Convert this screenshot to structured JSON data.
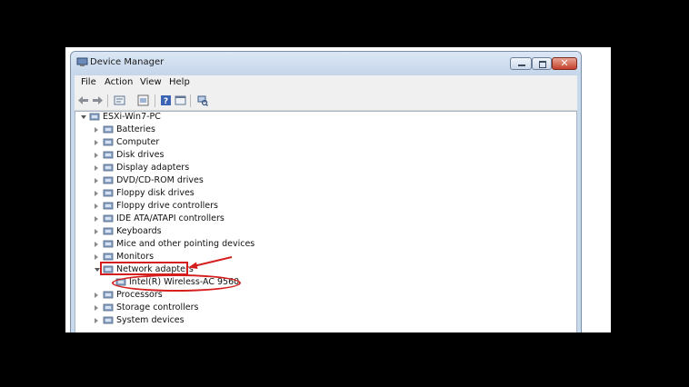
{
  "window": {
    "title": "Device Manager"
  },
  "menu": [
    "File",
    "Action",
    "View",
    "Help"
  ],
  "toolbar": [
    "back-icon",
    "forward-icon",
    "properties-icon",
    "show-hide-icon",
    "help-icon",
    "console-tree-icon",
    "scan-hardware-icon"
  ],
  "tree": {
    "root": "ESXi-Win7-PC",
    "items": [
      {
        "label": "Batteries",
        "icon": "battery-icon"
      },
      {
        "label": "Computer",
        "icon": "computer-icon"
      },
      {
        "label": "Disk drives",
        "icon": "disk-drive-icon"
      },
      {
        "label": "Display adapters",
        "icon": "display-adapter-icon"
      },
      {
        "label": "DVD/CD-ROM drives",
        "icon": "dvd-drive-icon"
      },
      {
        "label": "Floppy disk drives",
        "icon": "floppy-disk-icon"
      },
      {
        "label": "Floppy drive controllers",
        "icon": "floppy-controller-icon"
      },
      {
        "label": "IDE ATA/ATAPI controllers",
        "icon": "ide-controller-icon"
      },
      {
        "label": "Keyboards",
        "icon": "keyboard-icon"
      },
      {
        "label": "Mice and other pointing devices",
        "icon": "mouse-icon"
      },
      {
        "label": "Monitors",
        "icon": "monitor-icon"
      },
      {
        "label": "Network adapters",
        "icon": "network-adapter-icon",
        "expanded": true
      },
      {
        "label": "Intel(R) Wireless-AC 9560",
        "icon": "network-card-icon",
        "child": true
      },
      {
        "label": "Processors",
        "icon": "processor-icon"
      },
      {
        "label": "Storage controllers",
        "icon": "storage-controller-icon"
      },
      {
        "label": "System devices",
        "icon": "system-device-icon"
      }
    ]
  },
  "annotation_color": "#d51f1f"
}
